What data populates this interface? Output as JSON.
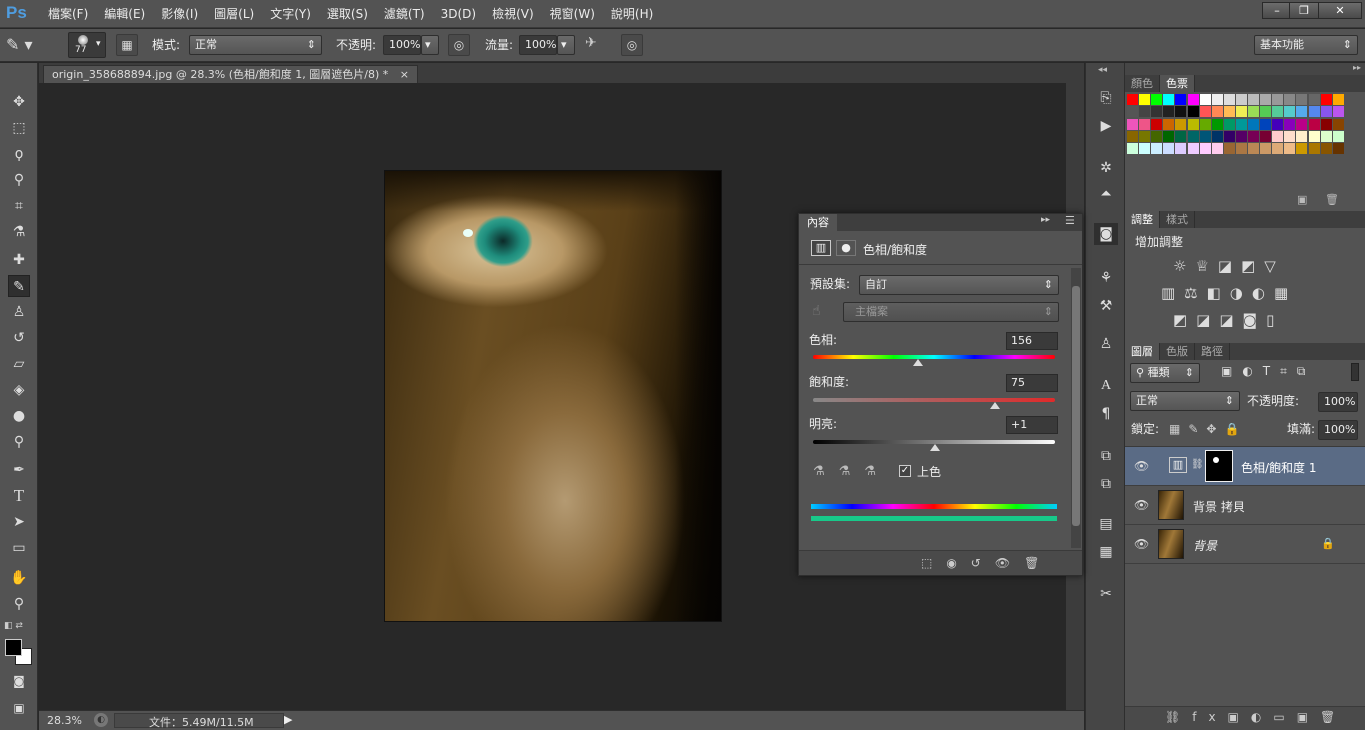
{
  "app": {
    "logo": "Ps",
    "menu": [
      "檔案(F)",
      "編輯(E)",
      "影像(I)",
      "圖層(L)",
      "文字(Y)",
      "選取(S)",
      "濾鏡(T)",
      "3D(D)",
      "檢視(V)",
      "視窗(W)",
      "說明(H)"
    ],
    "window_buttons": [
      "–",
      "❐",
      "✕"
    ]
  },
  "options": {
    "brush_size": "77",
    "mode_label": "模式:",
    "mode_value": "正常",
    "opacity_label": "不透明:",
    "opacity_value": "100%",
    "flow_label": "流量:",
    "flow_value": "100%",
    "workspace": "基本功能"
  },
  "document": {
    "tab_title": "origin_358688894.jpg @ 28.3% (色相/飽和度 1, 圖層遮色片/8) *",
    "tab_close": "×"
  },
  "status": {
    "zoom": "28.3%",
    "file_info": "文件：5.49M/11.5M"
  },
  "swatches_panel": {
    "tabs": [
      "顏色",
      "色票"
    ],
    "active": 1
  },
  "adjust_panel": {
    "tabs": [
      "調整",
      "樣式"
    ],
    "active": 0,
    "title": "增加調整"
  },
  "layers_panel": {
    "tabs": [
      "圖層",
      "色版",
      "路徑"
    ],
    "active": 0,
    "filter": "種類",
    "blend": "正常",
    "opacity_label": "不透明度:",
    "opacity_value": "100%",
    "lock_label": "鎖定:",
    "fill_label": "填滿:",
    "fill_value": "100%",
    "layers": [
      {
        "name": "色相/飽和度 1",
        "selected": true
      },
      {
        "name": "背景 拷貝",
        "selected": false
      },
      {
        "name": "背景",
        "selected": false
      }
    ]
  },
  "properties": {
    "tab": "內容",
    "title": "色相/飽和度",
    "preset_label": "預設集:",
    "preset_value": "自訂",
    "channel_value": "主檔案",
    "hue_label": "色相:",
    "hue_value": "156",
    "hue": 156,
    "sat_label": "飽和度:",
    "sat_value": "75",
    "sat": 75,
    "light_label": "明亮:",
    "light_value": "+1",
    "light": 1,
    "colorize_label": "上色",
    "colorize_checked": true
  },
  "colors": {
    "accent": "#4f9de0",
    "panel": "#535353",
    "selected_layer": "#5a6b85"
  }
}
